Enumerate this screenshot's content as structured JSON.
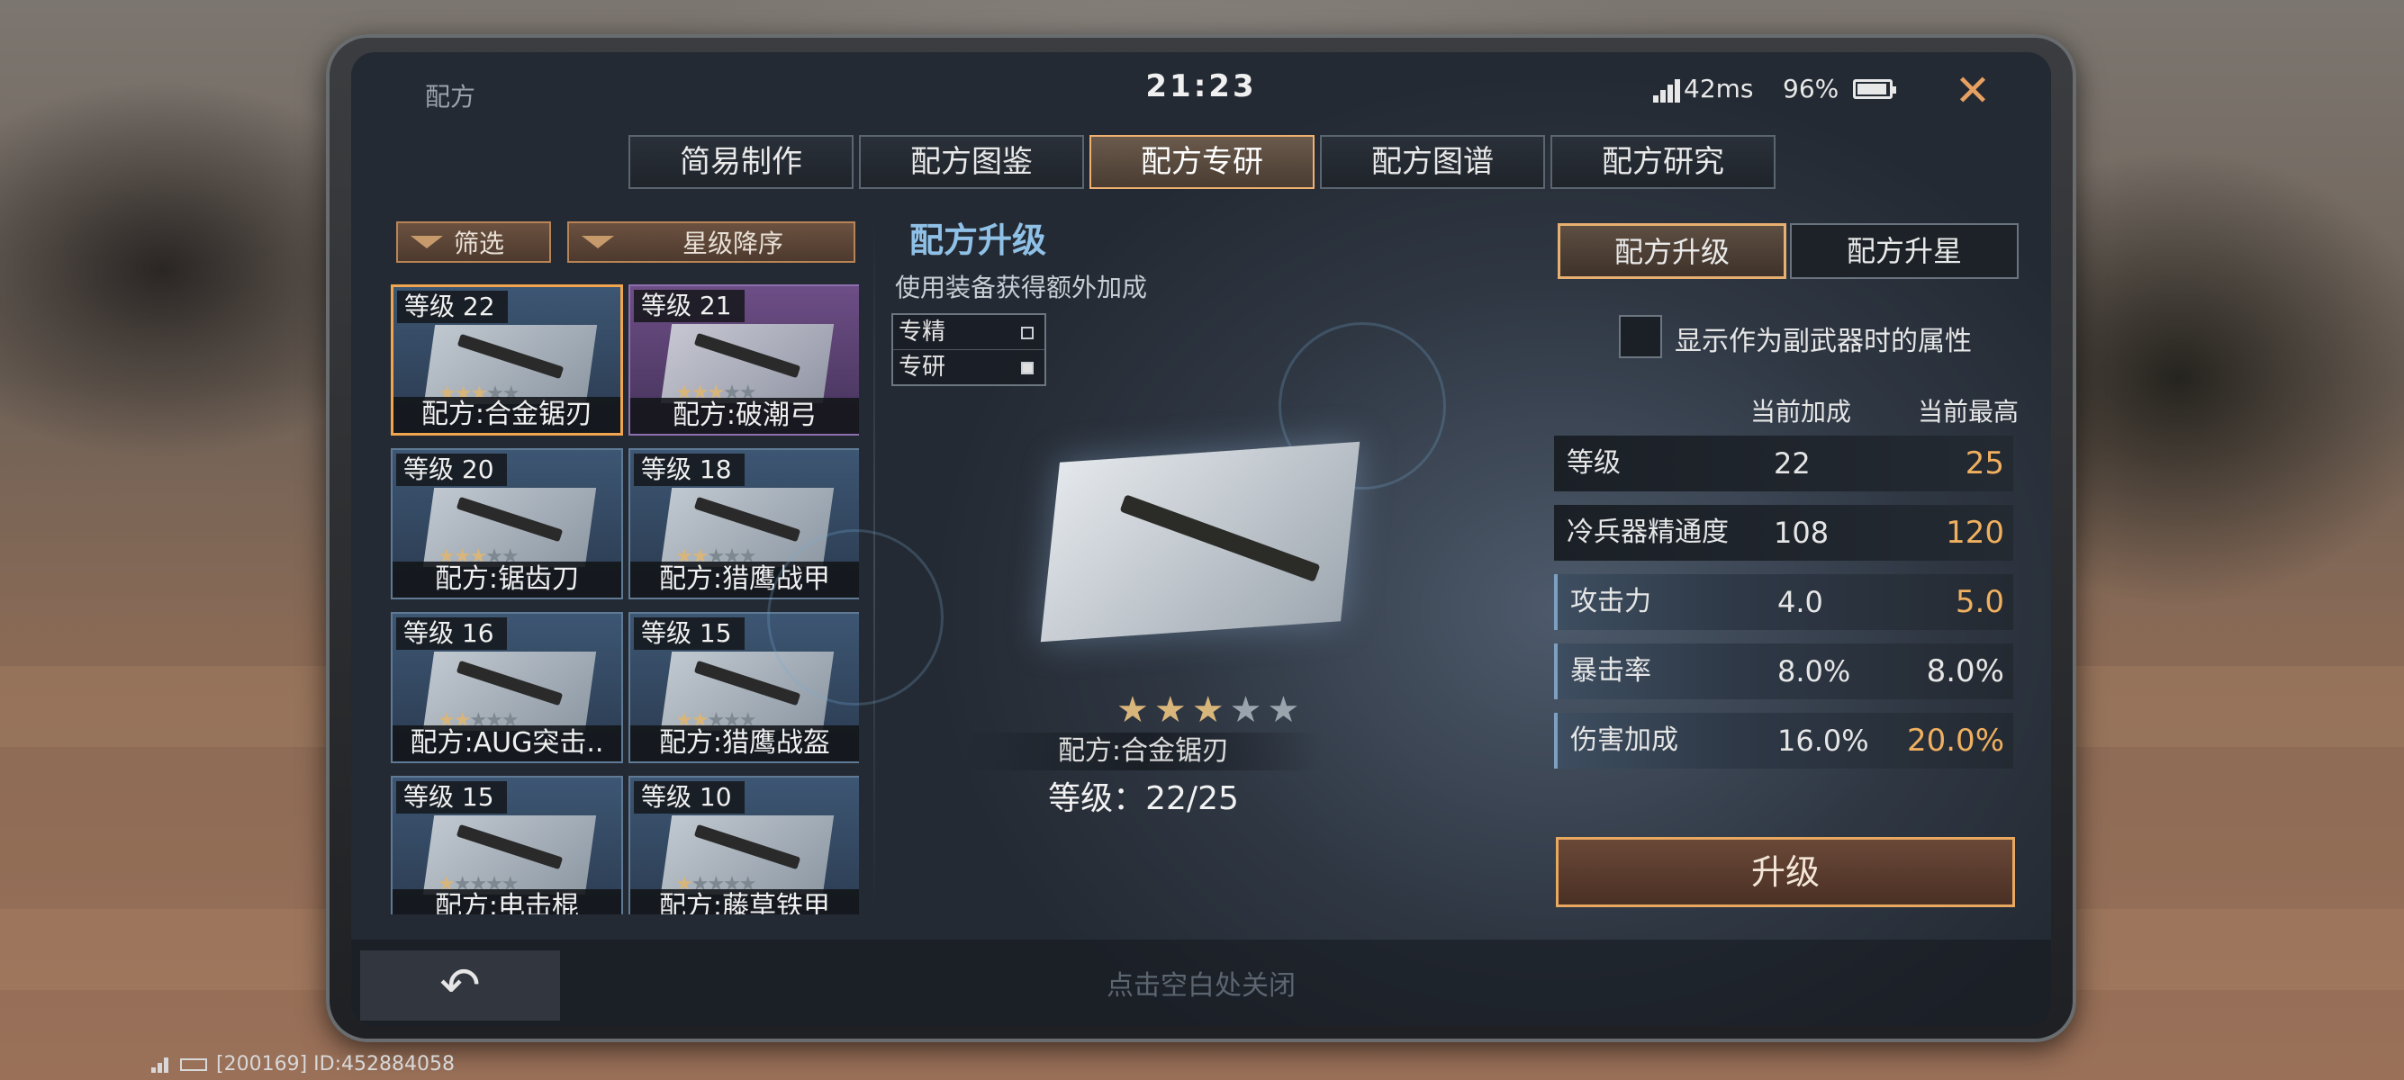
{
  "window": {
    "title": "配方",
    "clock": "21:23",
    "ping": "42ms",
    "battery": "96%",
    "close_glyph": "✕"
  },
  "tabs": [
    "简易制作",
    "配方图鉴",
    "配方专研",
    "配方图谱",
    "配方研究"
  ],
  "active_tab": 2,
  "filters": {
    "filter_label": "筛选",
    "sort_label": "星级降序"
  },
  "recipes": [
    {
      "level": "等级 22",
      "name": "配方:合金锯刃",
      "stars": 3
    },
    {
      "level": "等级 21",
      "name": "配方:破潮弓",
      "stars": 3
    },
    {
      "level": "等级 20",
      "name": "配方:锯齿刀",
      "stars": 3
    },
    {
      "level": "等级 18",
      "name": "配方:猎鹰战甲",
      "stars": 2
    },
    {
      "level": "等级 16",
      "name": "配方:AUG突击..",
      "stars": 2
    },
    {
      "level": "等级 15",
      "name": "配方:猎鹰战盔",
      "stars": 2
    },
    {
      "level": "等级 15",
      "name": "配方:电击棍",
      "stars": 1
    },
    {
      "level": "等级 10",
      "name": "配方:藤草铁甲",
      "stars": 1
    }
  ],
  "center": {
    "title": "配方升级",
    "subtitle": "使用装备获得额外加成",
    "legend": [
      "专精",
      "专研"
    ],
    "stars_on": 3,
    "stars_total": 5,
    "item_name": "配方:合金锯刃",
    "item_level": "等级：22/25"
  },
  "right": {
    "tabs": [
      "配方升级",
      "配方升星"
    ],
    "checkbox_label": "显示作为副武器时的属性",
    "col_current": "当前加成",
    "col_max": "当前最高",
    "stats": [
      {
        "label": "等级",
        "current": "22",
        "max": "25"
      },
      {
        "label": "冷兵器精通度",
        "current": "108",
        "max": "120"
      },
      {
        "label": "攻击力",
        "current": "4.0",
        "max": "5.0"
      },
      {
        "label": "暴击率",
        "current": "8.0%",
        "max": "8.0%"
      },
      {
        "label": "伤害加成",
        "current": "16.0%",
        "max": "20.0%"
      }
    ],
    "upgrade_label": "升级"
  },
  "bottom": {
    "back_glyph": "↶",
    "hint": "点击空白处关闭"
  },
  "footer": {
    "id_text": "[200169] ID:452884058"
  },
  "colors": {
    "accent": "#f0a54e",
    "blue_title": "#8fc0e6",
    "max_value": "#f0b060"
  }
}
